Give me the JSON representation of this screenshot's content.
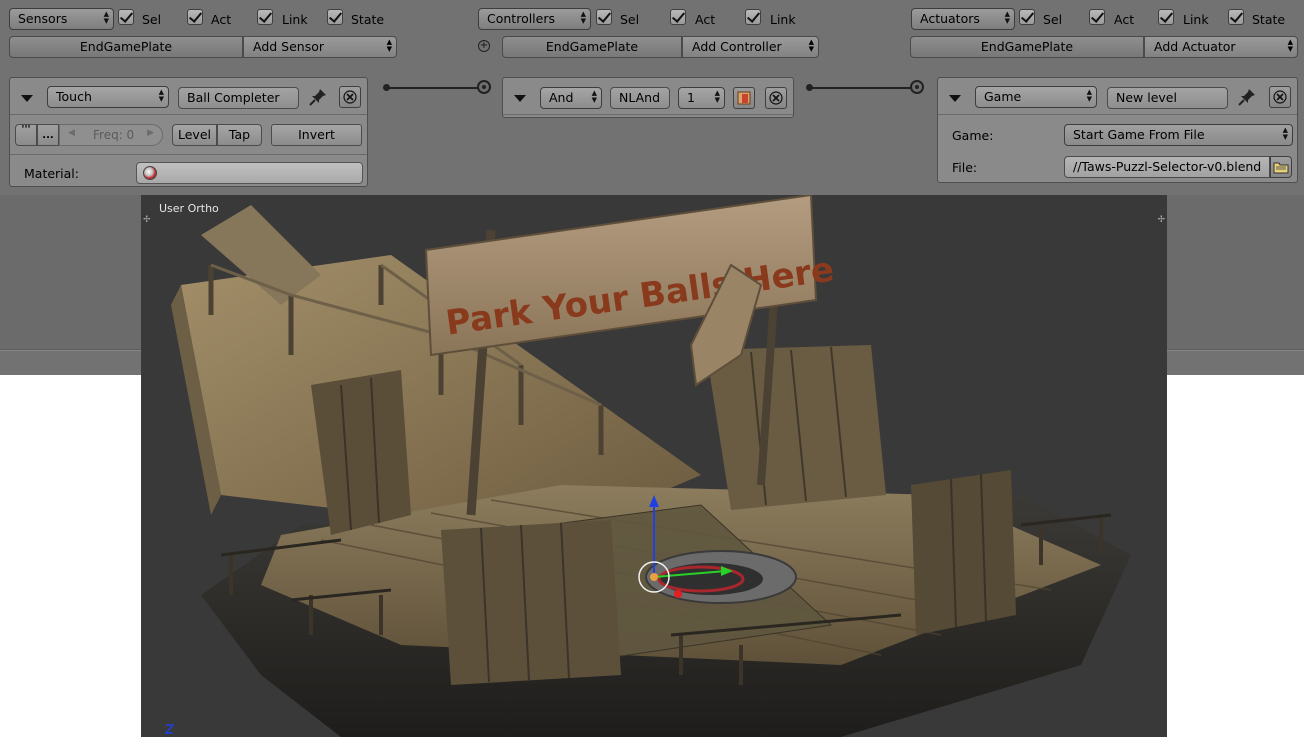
{
  "sensors_header": {
    "dropdown": "Sensors",
    "checks": [
      {
        "label": "Sel"
      },
      {
        "label": "Act"
      },
      {
        "label": "Link"
      },
      {
        "label": "State"
      }
    ],
    "object_name": "EndGamePlate",
    "add_label": "Add Sensor"
  },
  "controllers_header": {
    "dropdown": "Controllers",
    "checks": [
      {
        "label": "Sel"
      },
      {
        "label": "Act"
      },
      {
        "label": "Link"
      }
    ],
    "object_name": "EndGamePlate",
    "add_label": "Add Controller"
  },
  "actuators_header": {
    "dropdown": "Actuators",
    "checks": [
      {
        "label": "Sel"
      },
      {
        "label": "Act"
      },
      {
        "label": "Link"
      },
      {
        "label": "State"
      }
    ],
    "object_name": "EndGamePlate",
    "add_label": "Add Actuator"
  },
  "sensor": {
    "type": "Touch",
    "name": "Ball Completer",
    "freq_label": "Freq: 0",
    "level_label": "Level",
    "tap_label": "Tap",
    "invert_label": "Invert",
    "material_label": "Material:"
  },
  "controller": {
    "type": "And",
    "name": "NLAnd",
    "state": "1"
  },
  "actuator": {
    "type": "Game",
    "name": "New level",
    "game_label": "Game:",
    "game_value": "Start Game From File",
    "file_label": "File:",
    "file_value": "//Taws-Puzzl-Selector-v0.blend"
  },
  "viewport": {
    "view_label": "User Ortho",
    "sign_text": "Park Your Balls Here"
  },
  "colors": {
    "logic_bg": "#727272",
    "panel_bg": "#8a8a8a",
    "viewport_bg": "#393939",
    "axis_x": "#e02020",
    "axis_y": "#2ad02a",
    "axis_z": "#2040e0"
  }
}
